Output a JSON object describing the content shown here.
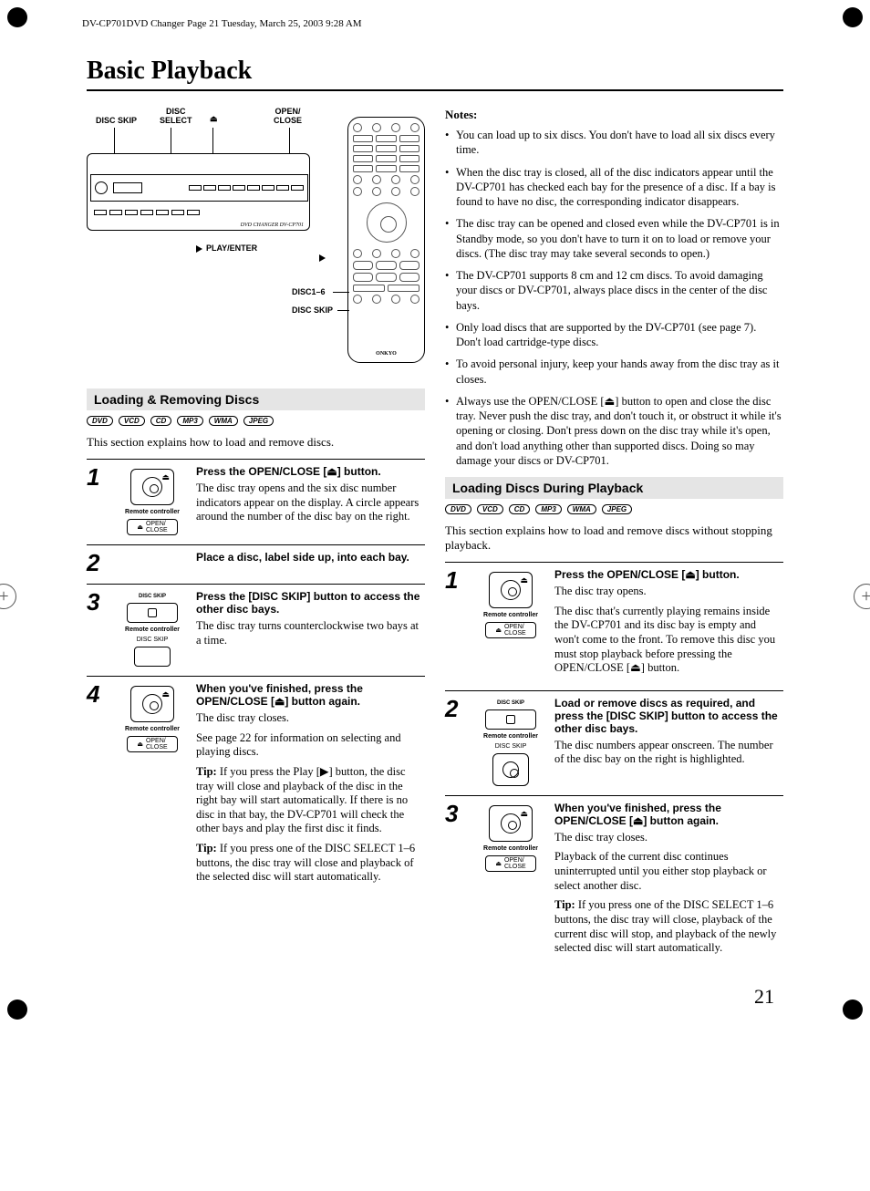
{
  "meta": {
    "header": "DV-CP701DVD Changer  Page 21  Tuesday, March 25, 2003  9:28 AM"
  },
  "title": "Basic Playback",
  "diagram": {
    "labels": {
      "disc_skip": "DISC SKIP",
      "disc_select": "DISC\nSELECT",
      "open_close": "OPEN/\nCLOSE",
      "play_enter": "PLAY/ENTER",
      "disc16": "DISC1–6",
      "disc_skip2": "DISC SKIP",
      "model": "DVD CHANGER DV-CP701"
    }
  },
  "sectionA": {
    "title": "Loading & Removing Discs",
    "formats": [
      "DVD",
      "VCD",
      "CD",
      "MP3",
      "WMA",
      "JPEG"
    ],
    "intro": "This section explains how to load and remove discs.",
    "steps": [
      {
        "num": "1",
        "ill_caption": "Remote controller",
        "btn_label": "OPEN/\nCLOSE",
        "title": "Press the OPEN/CLOSE [⏏] button.",
        "body": [
          "The disc tray opens and the six disc number indicators appear on the display. A circle appears around the number of the disc bay on the right."
        ]
      },
      {
        "num": "2",
        "title": "Place a disc, label side up, into each bay.",
        "body": []
      },
      {
        "num": "3",
        "ill_caption": "Remote controller",
        "btn_label": "DISC SKIP",
        "btn_top": "DISC SKIP",
        "title": "Press the [DISC SKIP] button to access the other disc bays.",
        "body": [
          "The disc tray turns counterclockwise two bays at a time."
        ]
      },
      {
        "num": "4",
        "ill_caption": "Remote controller",
        "btn_label": "OPEN/\nCLOSE",
        "title": "When you've finished, press the OPEN/CLOSE [⏏] button again.",
        "body": [
          "The disc tray closes.",
          "See page 22 for information on selecting and playing discs."
        ],
        "tips": [
          "If you press the Play [▶] button, the disc tray will close and playback of the disc in the right bay will start automatically. If there is no disc in that bay, the DV-CP701 will check the other bays and play the first disc it finds.",
          "If you press one of the DISC SELECT 1–6 buttons, the disc tray will close and playback of the selected disc will start automatically."
        ]
      }
    ]
  },
  "notes": {
    "title": "Notes:",
    "items": [
      "You can load up to six discs. You don't have to load all six discs every time.",
      "When the disc tray is closed, all of the disc indicators appear until the DV-CP701 has checked each bay for the presence of a disc. If a bay is found to have no disc, the corresponding indicator disappears.",
      "The disc tray can be opened and closed even while the DV-CP701 is in Standby mode, so you don't have to turn it on to load or remove your discs. (The disc tray may take several seconds to open.)",
      "The DV-CP701 supports 8 cm and 12 cm discs. To avoid damaging your discs or DV-CP701, always place discs in the center of the disc bays.",
      "Only load discs that are supported by the DV-CP701 (see page 7). Don't load cartridge-type discs.",
      "To avoid personal injury, keep your hands away from the disc tray as it closes.",
      "Always use the OPEN/CLOSE [⏏] button to open and close the disc tray. Never push the disc tray, and don't touch it, or obstruct it while it's opening or closing. Don't press down on the disc tray while it's open, and don't load anything other than supported discs. Doing so may damage your discs or DV-CP701."
    ]
  },
  "sectionB": {
    "title": "Loading Discs During Playback",
    "formats": [
      "DVD",
      "VCD",
      "CD",
      "MP3",
      "WMA",
      "JPEG"
    ],
    "intro": "This section explains how to load and remove discs without stopping playback.",
    "steps": [
      {
        "num": "1",
        "ill_caption": "Remote controller",
        "btn_label": "OPEN/\nCLOSE",
        "title": "Press the OPEN/CLOSE [⏏] button.",
        "body": [
          "The disc tray opens.",
          "The disc that's currently playing remains inside the DV-CP701 and its disc bay is empty and won't come to the front. To remove this disc you must stop playback before pressing the OPEN/CLOSE [⏏] button."
        ]
      },
      {
        "num": "2",
        "ill_caption": "Remote controller",
        "btn_label": "DISC SKIP",
        "btn_top": "DISC SKIP",
        "title": "Load or remove discs as required, and press the [DISC SKIP] button to access the other disc bays.",
        "body": [
          "The disc numbers appear onscreen. The number of the disc bay on the right is highlighted."
        ]
      },
      {
        "num": "3",
        "ill_caption": "Remote controller",
        "btn_label": "OPEN/\nCLOSE",
        "title": "When you've finished, press the OPEN/CLOSE [⏏] button again.",
        "body": [
          "The disc tray closes.",
          "Playback of the current disc continues uninterrupted until you either stop playback or select another disc."
        ],
        "tips": [
          "If you press one of the DISC SELECT 1–6 buttons, the disc tray will close, playback of the current disc will stop, and playback of the newly selected disc will start automatically."
        ]
      }
    ]
  },
  "tip_label": "Tip:",
  "page_num": "21"
}
